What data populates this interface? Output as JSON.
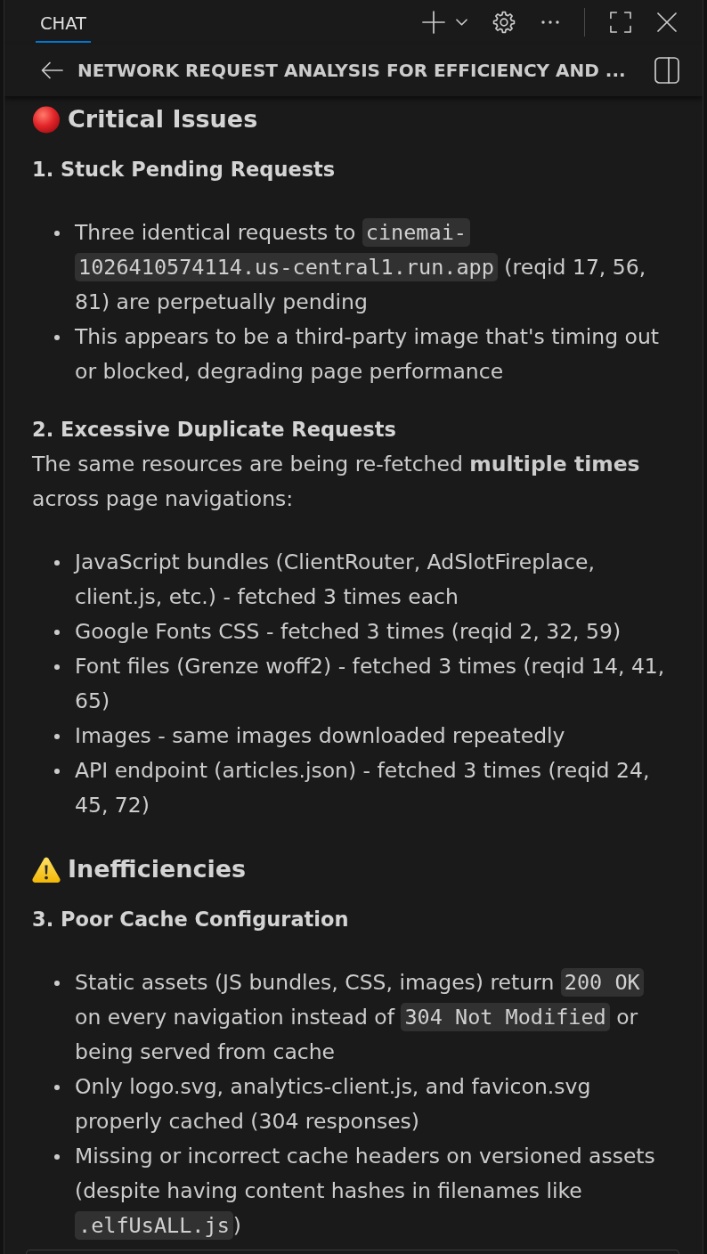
{
  "header": {
    "tabs": [
      {
        "label": "CHAT",
        "selected": true
      }
    ]
  },
  "title_bar": {
    "title": "NETWORK REQUEST ANALYSIS FOR EFFICIENCY AND ..."
  },
  "sections": [
    {
      "kind": "critical",
      "heading": "Critical Issues",
      "blocks": [
        {
          "kind": "subheading",
          "text": "1. Stuck Pending Requests"
        },
        {
          "kind": "list",
          "items": [
            [
              {
                "kind": "text",
                "text": "Three identical requests to "
              },
              {
                "kind": "code",
                "text": "cinemai-1026410574114.us-central1.run.app"
              },
              {
                "kind": "text",
                "text": " (reqid 17, 56, 81) are perpetually pending"
              }
            ],
            [
              {
                "kind": "text",
                "text": "This appears to be a third-party image that's timing out or blocked, degrading page performance"
              }
            ]
          ]
        },
        {
          "kind": "subheading",
          "text": "2. Excessive Duplicate Requests"
        },
        {
          "kind": "paragraph",
          "text": "The same resources are being re-fetched **multiple times** across page navigations:"
        },
        {
          "kind": "list",
          "items": [
            [
              {
                "kind": "text",
                "text": "JavaScript bundles (ClientRouter, AdSlotFireplace, client.js, etc.) - fetched 3 times each"
              }
            ],
            [
              {
                "kind": "text",
                "text": "Google Fonts CSS - fetched 3 times (reqid 2, 32, 59)"
              }
            ],
            [
              {
                "kind": "text",
                "text": "Font files (Grenze woff2) - fetched 3 times (reqid 14, 41, 65)"
              }
            ],
            [
              {
                "kind": "text",
                "text": "Images - same images downloaded repeatedly"
              }
            ],
            [
              {
                "kind": "text",
                "text": "API endpoint (articles.json) - fetched 3 times (reqid 24, 45, 72)"
              }
            ]
          ]
        }
      ]
    },
    {
      "kind": "warning",
      "heading": "Inefficiencies",
      "blocks": [
        {
          "kind": "subheading",
          "text": "3. Poor Cache Configuration"
        },
        {
          "kind": "list",
          "items": [
            [
              {
                "kind": "text",
                "text": "Static assets (JS bundles, CSS, images) return "
              },
              {
                "kind": "code",
                "text": "200 OK"
              },
              {
                "kind": "text",
                "text": " on every navigation instead of "
              },
              {
                "kind": "code",
                "text": "304 Not Modified"
              },
              {
                "kind": "text",
                "text": " or being served from cache"
              }
            ],
            [
              {
                "kind": "text",
                "text": "Only logo.svg, analytics-client.js, and favicon.svg properly cached (304 responses)"
              }
            ],
            [
              {
                "kind": "text",
                "text": "Missing or incorrect cache headers on versioned assets (despite having content hashes in filenames like "
              },
              {
                "kind": "code",
                "text": ".elfUsALL.js"
              },
              {
                "kind": "text",
                "text": ")"
              }
            ]
          ]
        }
      ]
    }
  ]
}
